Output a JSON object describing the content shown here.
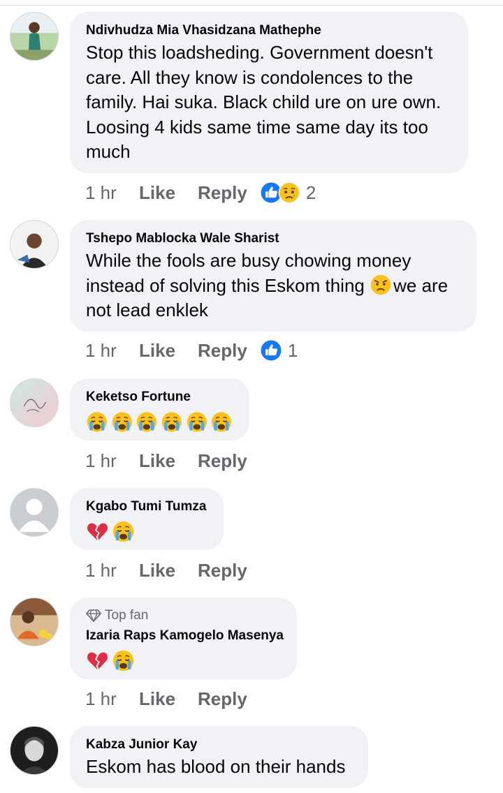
{
  "comments": [
    {
      "author": "Ndivhudza Mia Vhasidzana Mathephe",
      "text": "Stop this loadsheding. Government doesn't care. All they know is condolences to the family. Hai suka. Black child ure on ure own. Loosing 4 kids same time same day its too much",
      "time": "1 hr",
      "like_label": "Like",
      "reply_label": "Reply",
      "reactions": [
        "like-icon",
        "sad-icon"
      ],
      "reaction_count": "2"
    },
    {
      "author": "Tshepo Mablocka Wale Sharist",
      "text_before_emoji": "While the fools are busy chowing money instead of solving this Eskom thing",
      "inline_emoji": "angry-face-emoji",
      "text_after_emoji": "we are not lead enklek",
      "time": "1 hr",
      "like_label": "Like",
      "reply_label": "Reply",
      "reactions": [
        "like-icon"
      ],
      "reaction_count": "1"
    },
    {
      "author": "Keketso Fortune",
      "emojis": [
        "crying-face-emoji",
        "crying-face-emoji",
        "crying-face-emoji",
        "crying-face-emoji",
        "crying-face-emoji",
        "crying-face-emoji"
      ],
      "time": "1 hr",
      "like_label": "Like",
      "reply_label": "Reply"
    },
    {
      "author": "Kgabo Tumi Tumza",
      "emojis": [
        "broken-heart-emoji",
        "crying-face-emoji"
      ],
      "time": "1 hr",
      "like_label": "Like",
      "reply_label": "Reply"
    },
    {
      "badge": "Top fan",
      "author": "Izaria Raps Kamogelo Masenya",
      "emojis": [
        "broken-heart-emoji",
        "crying-face-emoji"
      ],
      "time": "1 hr",
      "like_label": "Like",
      "reply_label": "Reply"
    },
    {
      "author": "Kabza Junior Kay",
      "text": "Eskom has blood on their hands"
    }
  ],
  "colors": {
    "bubble": "#f0f2f5",
    "meta_text": "#65676b",
    "like_blue": "#1877f2",
    "emoji_yellow": "#fcc21b"
  }
}
